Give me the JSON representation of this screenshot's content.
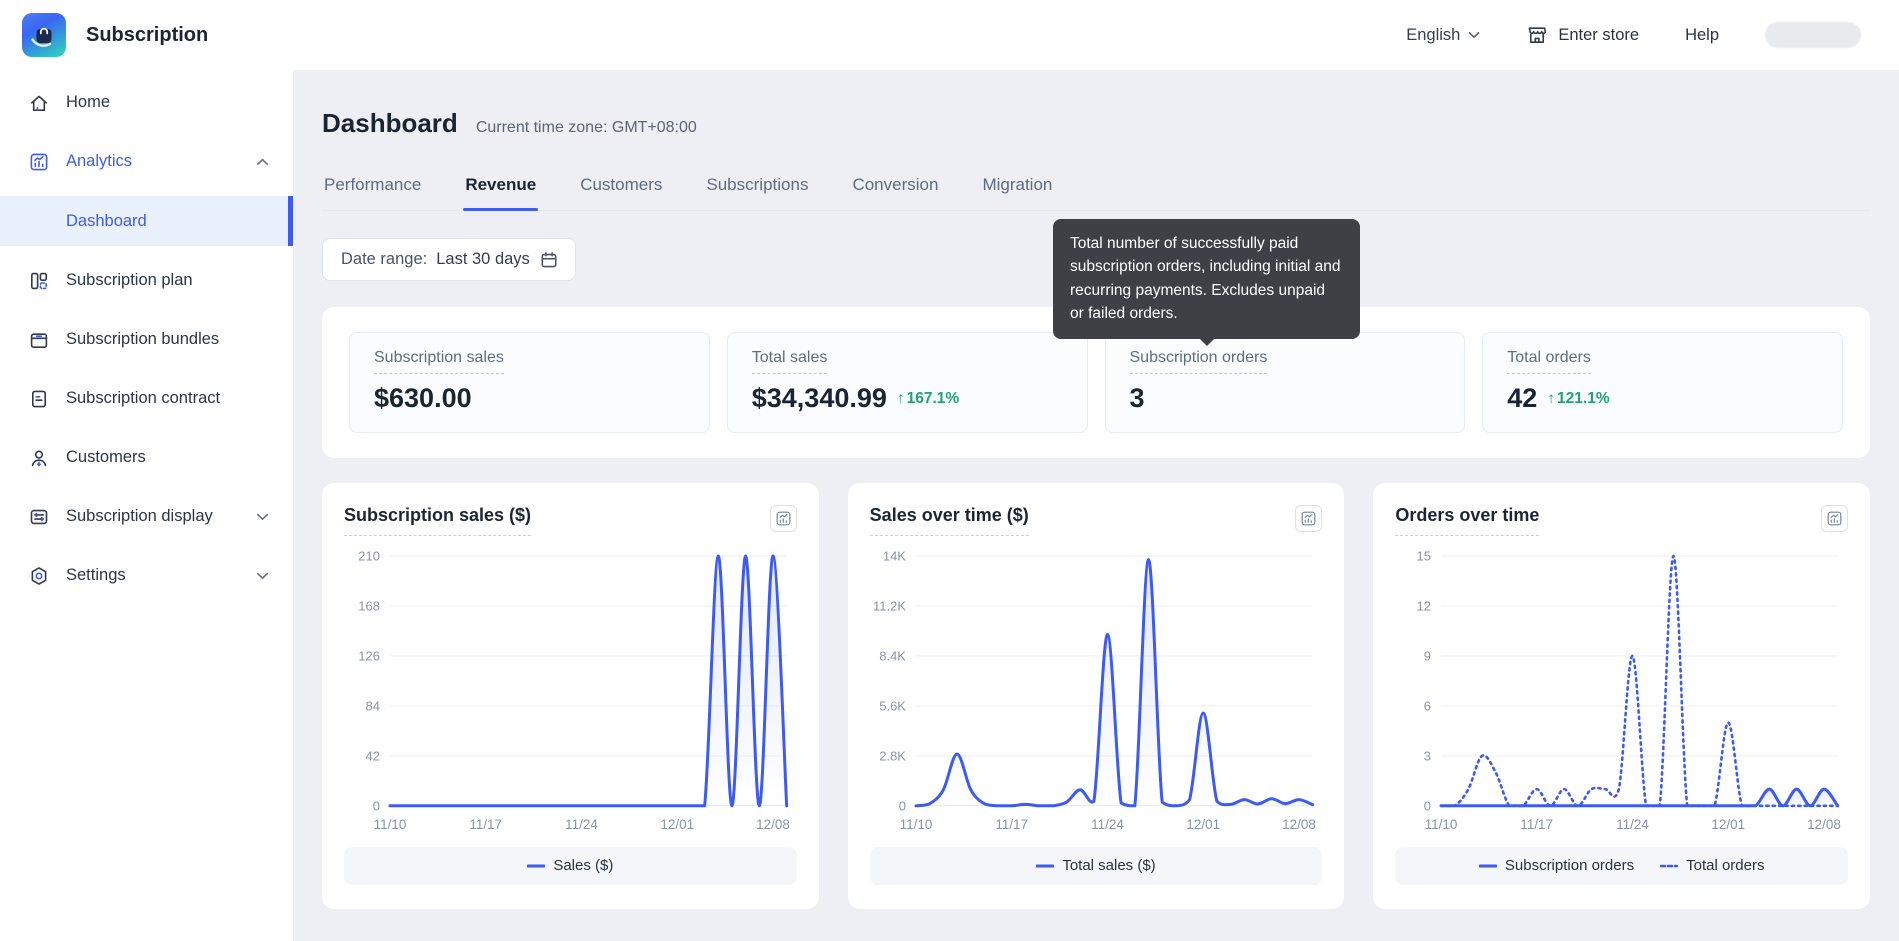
{
  "header": {
    "app_title": "Subscription",
    "language": "English",
    "enter_store": "Enter store",
    "help": "Help"
  },
  "sidebar": {
    "items": [
      {
        "label": "Home"
      },
      {
        "label": "Analytics",
        "active": true,
        "expanded": true,
        "children": [
          {
            "label": "Dashboard",
            "active": true
          }
        ]
      },
      {
        "label": "Subscription plan"
      },
      {
        "label": "Subscription bundles"
      },
      {
        "label": "Subscription contract"
      },
      {
        "label": "Customers"
      },
      {
        "label": "Subscription display",
        "expanded": false
      },
      {
        "label": "Settings",
        "expanded": false
      }
    ]
  },
  "page": {
    "title": "Dashboard",
    "timezone": "Current time zone: GMT+08:00",
    "tabs": [
      "Performance",
      "Revenue",
      "Customers",
      "Subscriptions",
      "Conversion",
      "Migration"
    ],
    "active_tab": "Revenue",
    "date_range_label": "Date range:",
    "date_range_value": "Last 30 days"
  },
  "tooltip": {
    "text": "Total number of successfully paid subscription orders, including initial and recurring payments. Excludes unpaid or failed orders."
  },
  "stats": [
    {
      "label": "Subscription sales",
      "value": "$630.00"
    },
    {
      "label": "Total sales",
      "value": "$34,340.99",
      "delta": "167.1%",
      "delta_dir": "up"
    },
    {
      "label": "Subscription orders",
      "value": "3"
    },
    {
      "label": "Total orders",
      "value": "42",
      "delta": "121.1%",
      "delta_dir": "up"
    }
  ],
  "colors": {
    "accent": "#3d5af5",
    "green": "#1ea374",
    "grid": "#edeff3",
    "axis_text": "#8a93a5",
    "tooltip_bg": "#3e4046"
  },
  "chart_data": [
    {
      "type": "line",
      "title": "Subscription sales ($)",
      "x": [
        "11/10",
        "11/11",
        "11/12",
        "11/13",
        "11/14",
        "11/15",
        "11/16",
        "11/17",
        "11/18",
        "11/19",
        "11/20",
        "11/21",
        "11/22",
        "11/23",
        "11/24",
        "11/25",
        "11/26",
        "11/27",
        "11/28",
        "11/29",
        "11/30",
        "12/01",
        "12/02",
        "12/03",
        "12/04",
        "12/05",
        "12/06",
        "12/07",
        "12/08",
        "12/09"
      ],
      "xtick_labels": [
        "11/10",
        "11/17",
        "11/24",
        "12/01",
        "12/08"
      ],
      "xtick_indices": [
        0,
        7,
        14,
        21,
        28
      ],
      "ymax": 210,
      "yticks": [
        0,
        42,
        84,
        126,
        168,
        210
      ],
      "ytick_labels": [
        "0",
        "42",
        "84",
        "126",
        "168",
        "210"
      ],
      "grid": true,
      "legend_position": "bottom",
      "series": [
        {
          "name": "Sales ($)",
          "style": "solid",
          "values": [
            0,
            0,
            0,
            0,
            0,
            0,
            0,
            0,
            0,
            0,
            0,
            0,
            0,
            0,
            0,
            0,
            0,
            0,
            0,
            0,
            0,
            0,
            0,
            0,
            210,
            0,
            210,
            0,
            210,
            0
          ]
        }
      ]
    },
    {
      "type": "line",
      "title": "Sales over time ($)",
      "x": [
        "11/10",
        "11/11",
        "11/12",
        "11/13",
        "11/14",
        "11/15",
        "11/16",
        "11/17",
        "11/18",
        "11/19",
        "11/20",
        "11/21",
        "11/22",
        "11/23",
        "11/24",
        "11/25",
        "11/26",
        "11/27",
        "11/28",
        "11/29",
        "11/30",
        "12/01",
        "12/02",
        "12/03",
        "12/04",
        "12/05",
        "12/06",
        "12/07",
        "12/08",
        "12/09"
      ],
      "xtick_labels": [
        "11/10",
        "11/17",
        "11/24",
        "12/01",
        "12/08"
      ],
      "xtick_indices": [
        0,
        7,
        14,
        21,
        28
      ],
      "ymax": 14000,
      "yticks": [
        0,
        2800,
        5600,
        8400,
        11200,
        14000
      ],
      "ytick_labels": [
        "0",
        "2.8K",
        "5.6K",
        "8.4K",
        "11.2K",
        "14K"
      ],
      "grid": true,
      "legend_position": "bottom",
      "series": [
        {
          "name": "Total sales ($)",
          "style": "solid",
          "values": [
            0,
            120,
            900,
            2900,
            900,
            120,
            0,
            0,
            80,
            0,
            0,
            200,
            900,
            250,
            9600,
            150,
            0,
            13800,
            200,
            0,
            350,
            5200,
            250,
            80,
            350,
            100,
            400,
            120,
            350,
            60
          ]
        }
      ]
    },
    {
      "type": "line",
      "title": "Orders over time",
      "x": [
        "11/10",
        "11/11",
        "11/12",
        "11/13",
        "11/14",
        "11/15",
        "11/16",
        "11/17",
        "11/18",
        "11/19",
        "11/20",
        "11/21",
        "11/22",
        "11/23",
        "11/24",
        "11/25",
        "11/26",
        "11/27",
        "11/28",
        "11/29",
        "11/30",
        "12/01",
        "12/02",
        "12/03",
        "12/04",
        "12/05",
        "12/06",
        "12/07",
        "12/08",
        "12/09"
      ],
      "xtick_labels": [
        "11/10",
        "11/17",
        "11/24",
        "12/01",
        "12/08"
      ],
      "xtick_indices": [
        0,
        7,
        14,
        21,
        28
      ],
      "ymax": 15,
      "yticks": [
        0,
        3,
        6,
        9,
        12,
        15
      ],
      "ytick_labels": [
        "0",
        "3",
        "6",
        "9",
        "12",
        "15"
      ],
      "grid": true,
      "legend_position": "bottom",
      "series": [
        {
          "name": "Subscription orders",
          "style": "solid",
          "values": [
            0,
            0,
            0,
            0,
            0,
            0,
            0,
            0,
            0,
            0,
            0,
            0,
            0,
            0,
            0,
            0,
            0,
            0,
            0,
            0,
            0,
            0,
            0,
            0,
            1,
            0,
            1,
            0,
            1,
            0
          ]
        },
        {
          "name": "Total orders",
          "style": "dashed",
          "values": [
            0,
            0,
            1,
            3,
            2,
            0,
            0,
            1,
            0,
            1,
            0,
            1,
            1,
            1,
            9,
            0,
            0,
            15,
            0,
            0,
            0,
            5,
            0,
            0,
            0,
            0,
            0,
            0,
            0,
            0
          ]
        }
      ]
    }
  ]
}
